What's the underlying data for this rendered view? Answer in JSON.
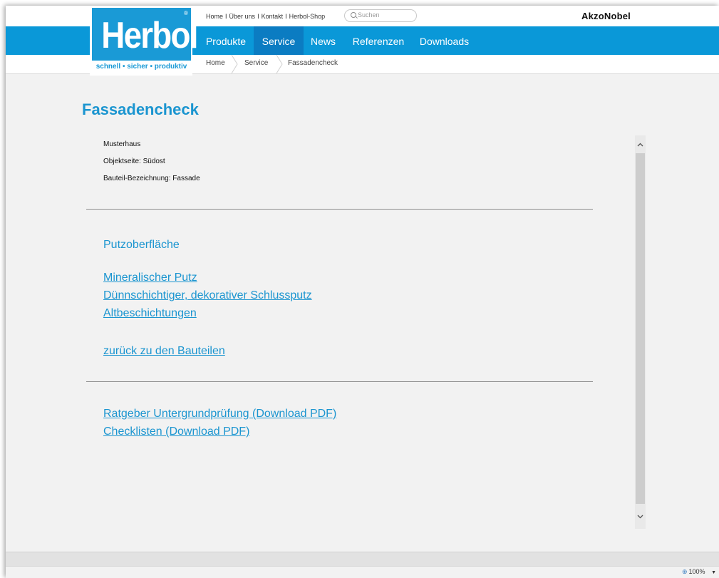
{
  "brand": {
    "logo_text": "Herbol",
    "tagline": "schnell • sicher • produktiv",
    "registered": "®",
    "partner_logo": "AkzoNobel"
  },
  "top_links": [
    "Home",
    "Über uns",
    "Kontakt",
    "Herbol-Shop"
  ],
  "search": {
    "placeholder": "Suchen"
  },
  "nav": {
    "items": [
      {
        "label": "Produkte",
        "active": false
      },
      {
        "label": "Service",
        "active": true
      },
      {
        "label": "News",
        "active": false
      },
      {
        "label": "Referenzen",
        "active": false
      },
      {
        "label": "Downloads",
        "active": false
      }
    ]
  },
  "breadcrumb": [
    "Home",
    "Service",
    "Fassadencheck"
  ],
  "page": {
    "title": "Fassadencheck",
    "info": [
      "Musterhaus",
      "Objektseite: Südost",
      "Bauteil-Bezeichnung: Fassade"
    ],
    "section_heading": "Putzoberfläche",
    "links": [
      "Mineralischer Putz",
      "Dünnschichtiger, dekorativer Schlussputz",
      "Altbeschichtungen"
    ],
    "back_link": "zurück zu den Bauteilen",
    "downloads": [
      "Ratgeber Untergrundprüfung (Download PDF)",
      "Checklisten (Download PDF)"
    ]
  },
  "status": {
    "zoom": "100%"
  },
  "colors": {
    "brand_blue": "#0a98d8",
    "active_nav": "#0b7cc2",
    "link_blue": "#1b95d0"
  }
}
